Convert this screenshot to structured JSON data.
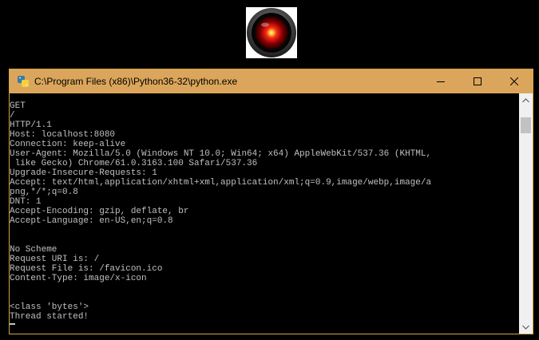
{
  "window": {
    "title": "C:\\Program Files (x86)\\Python36-32\\python.exe",
    "titlebar_color": "#dba65b",
    "icons": {
      "app": "python-icon",
      "minimize": "minimize-icon",
      "maximize": "maximize-icon",
      "close": "close-icon",
      "logo": "hal-9000-eye-icon"
    }
  },
  "console": {
    "text_color": "#c0c0c0",
    "background": "#000000",
    "lines": [
      "GET",
      "/",
      "HTTP/1.1",
      "Host: localhost:8080",
      "Connection: keep-alive",
      "User-Agent: Mozilla/5.0 (Windows NT 10.0; Win64; x64) AppleWebKit/537.36 (KHTML,",
      " like Gecko) Chrome/61.0.3163.100 Safari/537.36",
      "Upgrade-Insecure-Requests: 1",
      "Accept: text/html,application/xhtml+xml,application/xml;q=0.9,image/webp,image/a",
      "png,*/*;q=0.8",
      "DNT: 1",
      "Accept-Encoding: gzip, deflate, br",
      "Accept-Language: en-US,en;q=0.8",
      "",
      "",
      "No Scheme",
      "Request URI is: /",
      "Request File is: /favicon.ico",
      "Content-Type: image/x-icon",
      "",
      "",
      "<class 'bytes'>",
      "Thread started!"
    ]
  }
}
